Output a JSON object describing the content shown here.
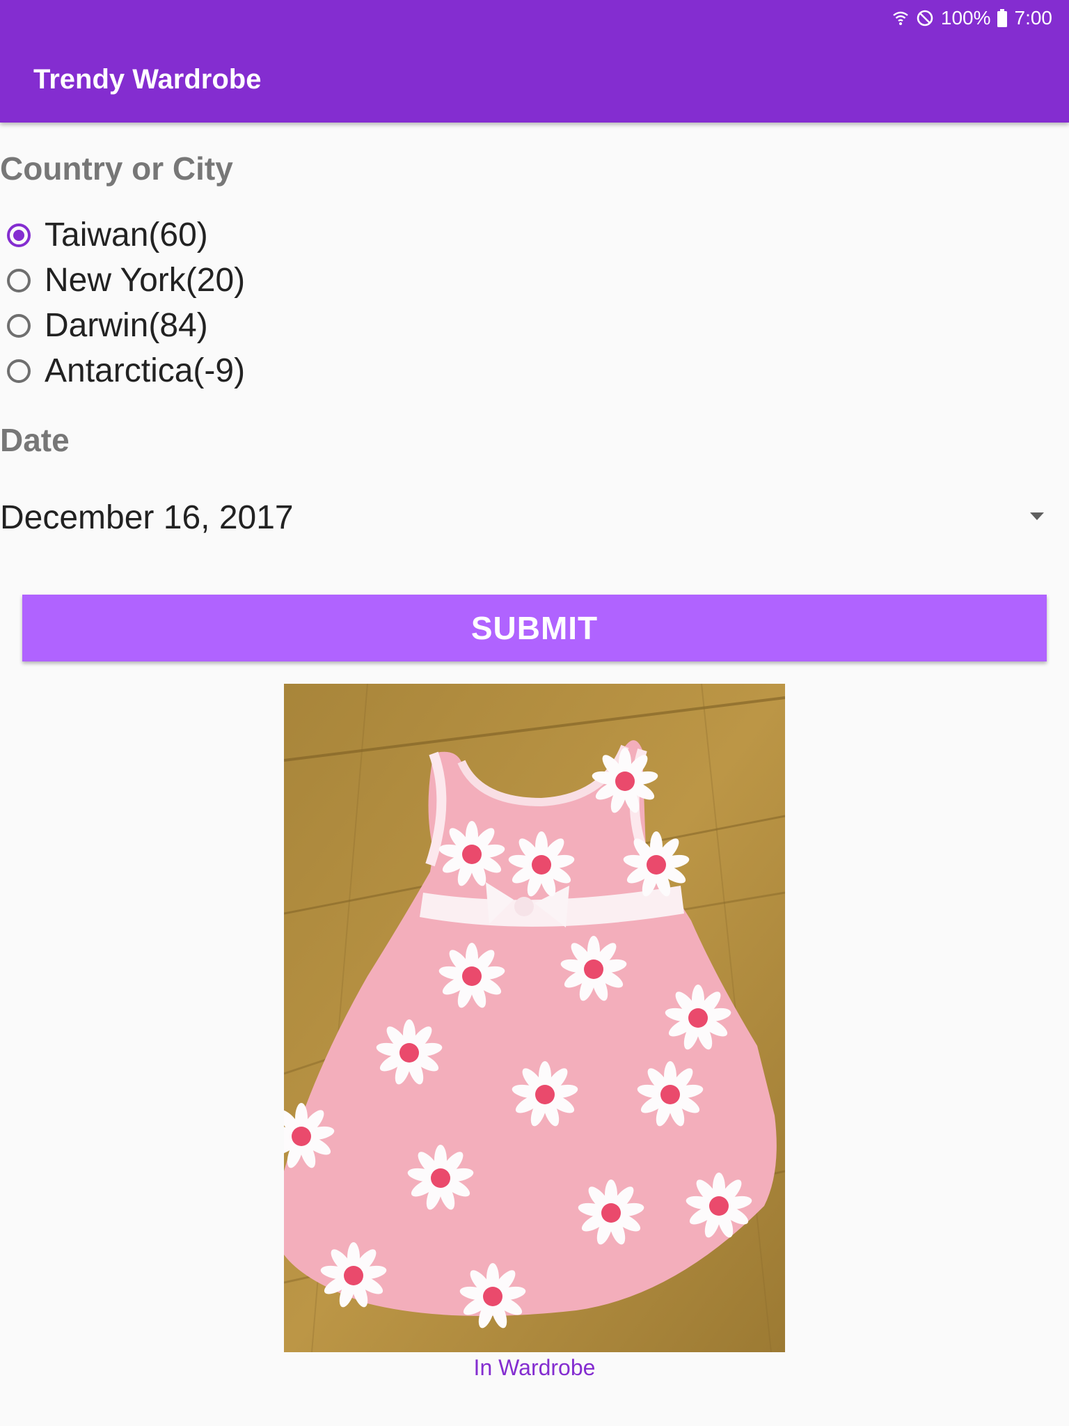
{
  "status_bar": {
    "battery": "100%",
    "time": "7:00",
    "icons": [
      "wifi-icon",
      "do-not-disturb-icon",
      "battery-icon"
    ]
  },
  "app_bar": {
    "title": "Trendy Wardrobe"
  },
  "location_section": {
    "label": "Country or City",
    "options": [
      {
        "label": "Taiwan(60)",
        "selected": true
      },
      {
        "label": "New York(20)",
        "selected": false
      },
      {
        "label": "Darwin(84)",
        "selected": false
      },
      {
        "label": "Antarctica(-9)",
        "selected": false
      }
    ]
  },
  "date_section": {
    "label": "Date",
    "selected_value": "December 16, 2017"
  },
  "actions": {
    "submit_label": "SUBMIT"
  },
  "outfit": {
    "caption": "In Wardrobe"
  },
  "colors": {
    "primary": "#842dd0",
    "button": "#b063ff",
    "caption": "#842dd0",
    "dress_pink": "#f3aebb",
    "flower_center": "#ea4a6c",
    "floor_wood": "#b8913f"
  }
}
